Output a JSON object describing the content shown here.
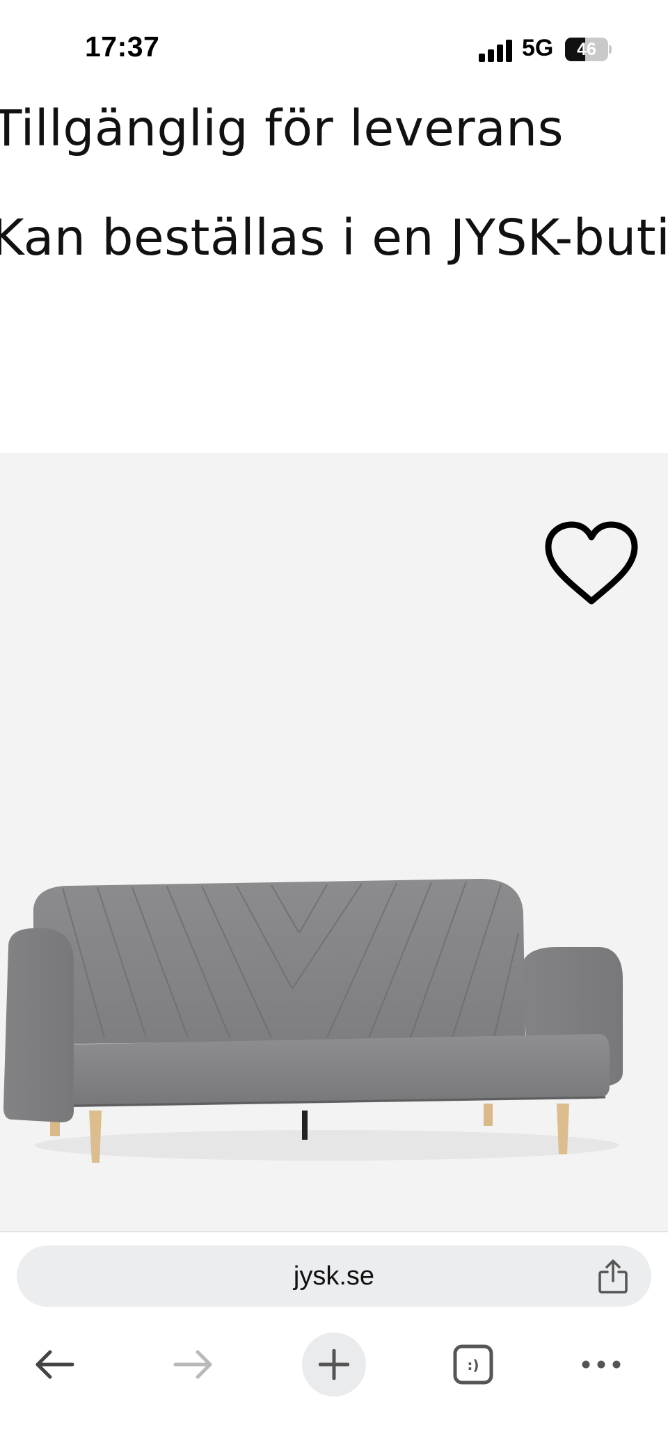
{
  "status_bar": {
    "time": "17:37",
    "network": "5G",
    "battery": "46",
    "battery_level": 0.46
  },
  "availability": {
    "delivery": "Tillgänglig för leverans",
    "store_order": "Kan beställas i en JYSK-buti"
  },
  "product": {
    "image_subject": "sofa-bed-grey",
    "favorite_icon": "heart-outline-icon",
    "colors": {
      "background": "#f3f3f3",
      "upholstery": "#8a8a8c",
      "legs": "#d9b98a"
    }
  },
  "browser": {
    "url": "jysk.se",
    "icons": {
      "share": "share-icon",
      "back": "arrow-left-icon",
      "forward": "arrow-right-icon",
      "new_tab": "plus-icon",
      "tabs": "tabs-icon",
      "more": "ellipsis-icon"
    },
    "tabs_glyph": ":)"
  }
}
